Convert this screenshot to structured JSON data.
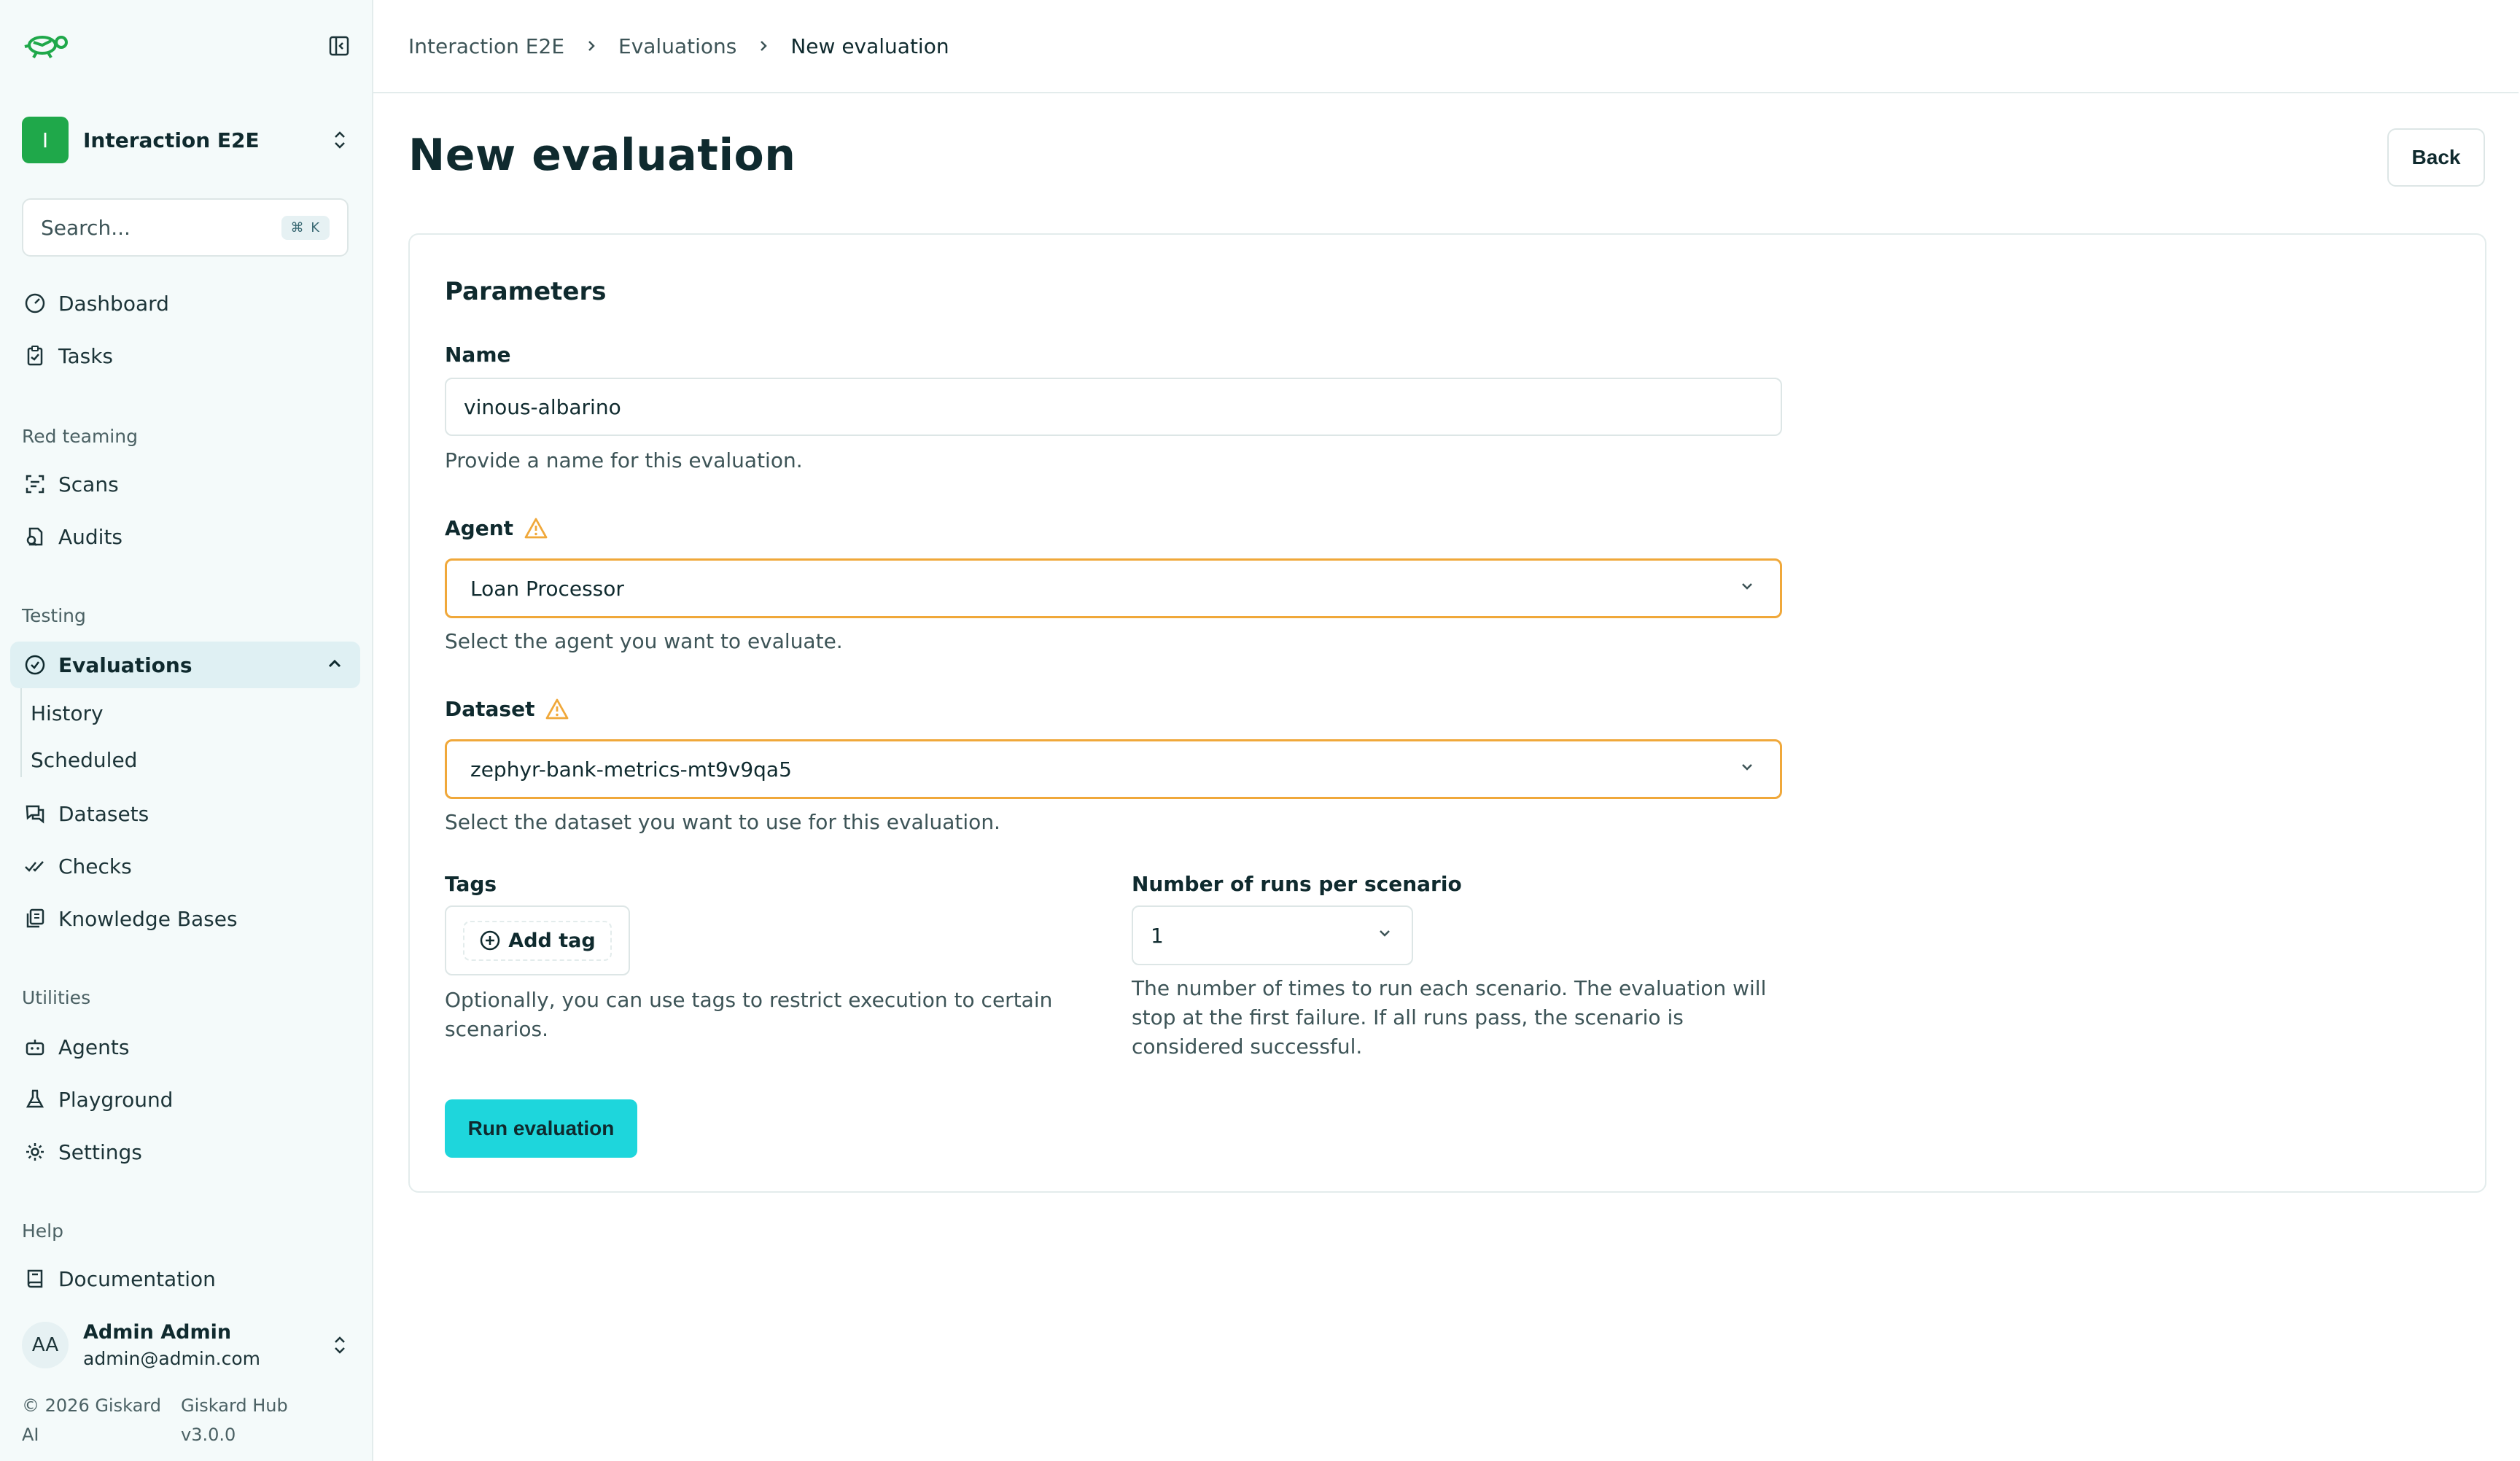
{
  "sidebar": {
    "project": {
      "initial": "I",
      "name": "Interaction E2E"
    },
    "search": {
      "placeholder": "Search...",
      "shortcut": "⌘ K"
    },
    "items_top": [
      {
        "label": "Dashboard",
        "icon": "dashboard-icon"
      },
      {
        "label": "Tasks",
        "icon": "tasks-icon"
      }
    ],
    "sections": {
      "red_teaming": "Red teaming",
      "testing": "Testing",
      "utilities": "Utilities",
      "help": "Help"
    },
    "red_teaming_items": [
      {
        "label": "Scans",
        "icon": "scans-icon"
      },
      {
        "label": "Audits",
        "icon": "audits-icon"
      }
    ],
    "evaluations": {
      "label": "Evaluations",
      "sub": [
        "History",
        "Scheduled"
      ]
    },
    "testing_items": [
      {
        "label": "Datasets",
        "icon": "datasets-icon"
      },
      {
        "label": "Checks",
        "icon": "checks-icon"
      },
      {
        "label": "Knowledge Bases",
        "icon": "knowledge-bases-icon"
      }
    ],
    "utilities_items": [
      {
        "label": "Agents",
        "icon": "agents-icon"
      },
      {
        "label": "Playground",
        "icon": "playground-icon"
      },
      {
        "label": "Settings",
        "icon": "settings-icon"
      }
    ],
    "help_items": [
      {
        "label": "Documentation",
        "icon": "documentation-icon"
      }
    ],
    "user": {
      "initials": "AA",
      "name": "Admin Admin",
      "email": "admin@admin.com"
    },
    "footer": {
      "copyright": "© 2026 Giskard AI",
      "version": "Giskard Hub v3.0.0"
    }
  },
  "breadcrumb": [
    "Interaction E2E",
    "Evaluations",
    "New evaluation"
  ],
  "page": {
    "title": "New evaluation",
    "back_label": "Back"
  },
  "form": {
    "title": "Parameters",
    "name": {
      "label": "Name",
      "value": "vinous-albarino",
      "help": "Provide a name for this evaluation."
    },
    "agent": {
      "label": "Agent",
      "value": "Loan Processor",
      "help": "Select the agent you want to evaluate."
    },
    "dataset": {
      "label": "Dataset",
      "value": "zephyr-bank-metrics-mt9v9qa5",
      "help": "Select the dataset you want to use for this evaluation."
    },
    "tags": {
      "label": "Tags",
      "add_label": "Add tag",
      "help": "Optionally, you can use tags to restrict execution to certain scenarios."
    },
    "runs": {
      "label": "Number of runs per scenario",
      "value": "1",
      "help": "The number of times to run each scenario. The evaluation will stop at the first failure. If all runs pass, the scenario is considered successful."
    },
    "submit_label": "Run evaluation"
  },
  "colors": {
    "accent": "#1ed6dc",
    "warning": "#f0a83a",
    "project": "#1fa84a"
  }
}
